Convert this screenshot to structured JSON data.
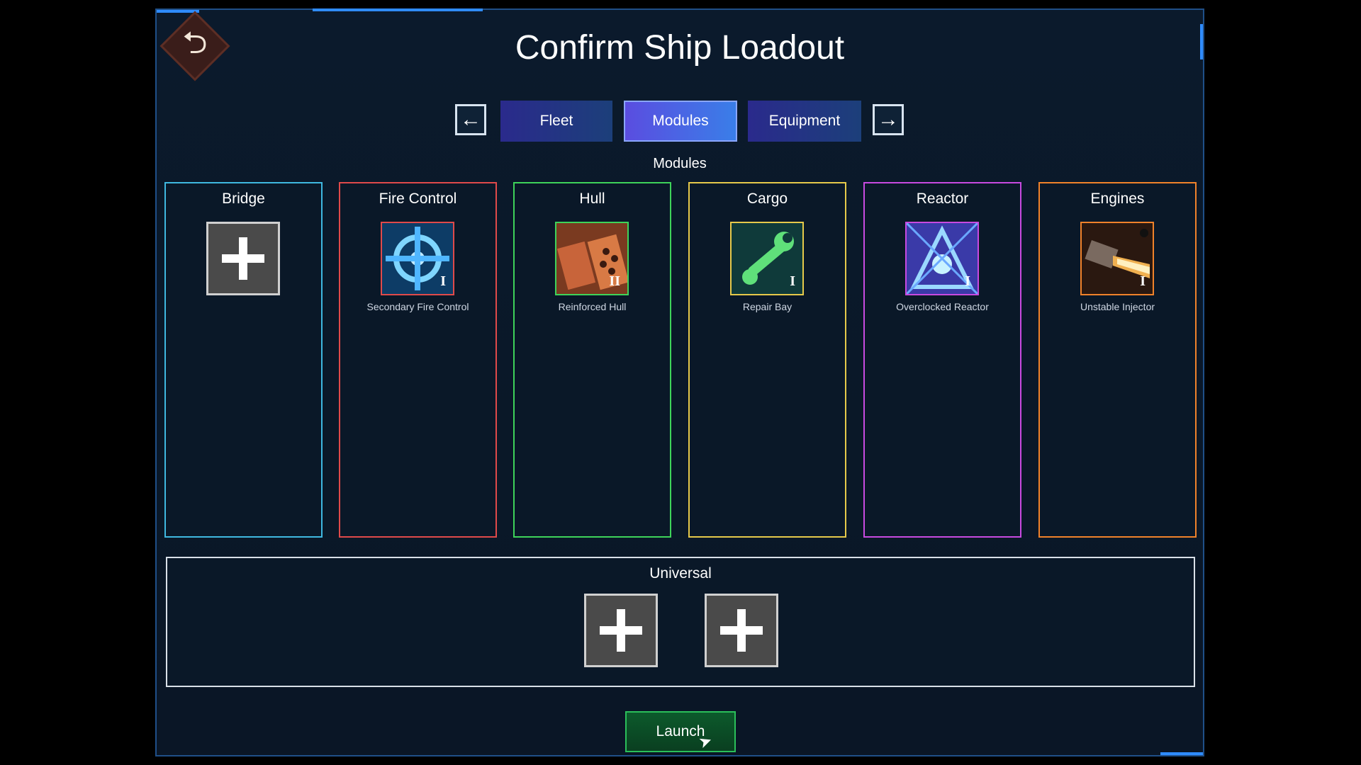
{
  "title": "Confirm Ship Loadout",
  "tabs": [
    "Fleet",
    "Modules",
    "Equipment"
  ],
  "active_tab": "Modules",
  "section_label": "Modules",
  "slots": [
    {
      "title": "Bridge",
      "color": "#3fb8e0",
      "module": null
    },
    {
      "title": "Fire Control",
      "color": "#e04a4a",
      "module": {
        "name": "Secondary Fire Control",
        "tier": "I",
        "icon": "crosshair-icon"
      }
    },
    {
      "title": "Hull",
      "color": "#3ed35a",
      "module": {
        "name": "Reinforced Hull",
        "tier": "II",
        "icon": "hull-plates-icon"
      }
    },
    {
      "title": "Cargo",
      "color": "#e6c94a",
      "module": {
        "name": "Repair Bay",
        "tier": "I",
        "icon": "wrench-icon"
      }
    },
    {
      "title": "Reactor",
      "color": "#c84ae0",
      "module": {
        "name": "Overclocked Reactor",
        "tier": "I",
        "icon": "reactor-core-icon"
      }
    },
    {
      "title": "Engines",
      "color": "#f0822a",
      "module": {
        "name": "Unstable Injector",
        "tier": "I",
        "icon": "injector-flame-icon"
      }
    }
  ],
  "universal": {
    "title": "Universal",
    "slots": 2
  },
  "launch_label": "Launch",
  "icons": {
    "back": "back-arrow-icon",
    "prev": "arrow-left-icon",
    "next": "arrow-right-icon",
    "add": "plus-icon"
  }
}
